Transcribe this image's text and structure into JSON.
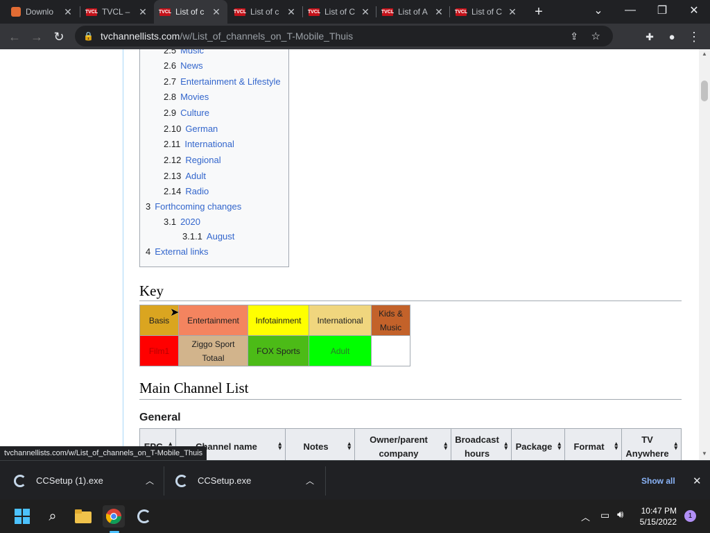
{
  "browser": {
    "tabs": [
      {
        "label": "Downlo",
        "favicon": "piriform-icon",
        "active": false
      },
      {
        "label": "TVCL –",
        "favicon": "tvcl-icon",
        "active": false
      },
      {
        "label": "List of c",
        "favicon": "tvcl-icon",
        "active": true
      },
      {
        "label": "List of c",
        "favicon": "tvcl-icon",
        "active": false
      },
      {
        "label": "List of C",
        "favicon": "tvcl-icon",
        "active": false
      },
      {
        "label": "List of A",
        "favicon": "tvcl-icon",
        "active": false
      },
      {
        "label": "List of C",
        "favicon": "tvcl-icon",
        "active": false
      }
    ],
    "favicon_text": "TVCL",
    "close_glyph": "✕",
    "new_tab_glyph": "+",
    "url_host": "tvchannellists.com",
    "url_path": "/w/List_of_channels_on_T-Mobile_Thuis",
    "status_url": "tvchannellists.com/w/List_of_channels_on_T-Mobile_Thuis"
  },
  "toc": [
    {
      "num": "2.5",
      "label": "Music",
      "level": 2
    },
    {
      "num": "2.6",
      "label": "News",
      "level": 2
    },
    {
      "num": "2.7",
      "label": "Entertainment & Lifestyle",
      "level": 2
    },
    {
      "num": "2.8",
      "label": "Movies",
      "level": 2
    },
    {
      "num": "2.9",
      "label": "Culture",
      "level": 2
    },
    {
      "num": "2.10",
      "label": "German",
      "level": 2
    },
    {
      "num": "2.11",
      "label": "International",
      "level": 2
    },
    {
      "num": "2.12",
      "label": "Regional",
      "level": 2
    },
    {
      "num": "2.13",
      "label": "Adult",
      "level": 2
    },
    {
      "num": "2.14",
      "label": "Radio",
      "level": 2
    },
    {
      "num": "3",
      "label": "Forthcoming changes",
      "level": 1
    },
    {
      "num": "3.1",
      "label": "2020",
      "level": 2
    },
    {
      "num": "3.1.1",
      "label": "August",
      "level": 3
    },
    {
      "num": "4",
      "label": "External links",
      "level": 1
    }
  ],
  "key_heading": "Key",
  "key_rows": [
    [
      {
        "label": "Basis",
        "bg": "#daa520",
        "fg": "#202122"
      },
      {
        "label": "Entertainment",
        "bg": "#f4845f",
        "fg": "#202122"
      },
      {
        "label": "Infotainment",
        "bg": "#ffff00",
        "fg": "#202122"
      },
      {
        "label": "International",
        "bg": "#f0d67e",
        "fg": "#202122"
      },
      {
        "label": "Kids & Music",
        "bg": "#c3622a",
        "fg": "#202122"
      }
    ],
    [
      {
        "label": "Film1",
        "bg": "#ff0000",
        "fg": "#b80000"
      },
      {
        "label": "Ziggo Sport Totaal",
        "bg": "#d2b48c",
        "fg": "#202122"
      },
      {
        "label": "FOX Sports",
        "bg": "#4cbb17",
        "fg": "#202122"
      },
      {
        "label": "Adult",
        "bg": "#00ff00",
        "fg": "#2a7a2a"
      },
      {
        "label": "",
        "bg": "#ffffff",
        "fg": "#202122"
      }
    ]
  ],
  "main_heading": "Main Channel List",
  "section_heading": "General",
  "table_headers": [
    "EPG",
    "Channel name",
    "Notes",
    "Owner/parent company",
    "Broadcast hours",
    "Package",
    "Format",
    "TV Anywhere"
  ],
  "downloads": {
    "items": [
      "CCSetup (1).exe",
      "CCSetup.exe"
    ],
    "show_all": "Show all"
  },
  "taskbar": {
    "time": "10:47 PM",
    "date": "5/15/2022",
    "notification_count": "1"
  }
}
